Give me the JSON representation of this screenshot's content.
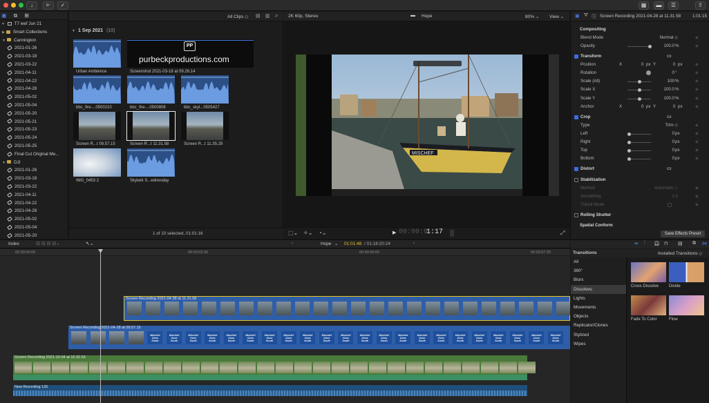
{
  "titlebar": {
    "controls": [
      "download-icon",
      "key-icon",
      "check-icon"
    ],
    "right_controls": [
      "layout-browser-icon",
      "layout-timeline-icon",
      "layout-inspector-icon",
      "share-icon"
    ]
  },
  "library": {
    "name": "T7 wef Jun 21",
    "items": [
      {
        "label": "Smart Collections",
        "type": "folder",
        "indent": 1
      },
      {
        "label": "Cannington",
        "type": "folder-open",
        "indent": 1
      },
      {
        "label": "2021-01-26",
        "type": "event",
        "indent": 2
      },
      {
        "label": "2021-03-18",
        "type": "event",
        "indent": 2
      },
      {
        "label": "2021-03-22",
        "type": "event",
        "indent": 2
      },
      {
        "label": "2021-04-11",
        "type": "event",
        "indent": 2
      },
      {
        "label": "2021-04-22",
        "type": "event",
        "indent": 2
      },
      {
        "label": "2021-04-28",
        "type": "event",
        "indent": 2
      },
      {
        "label": "2021-05-02",
        "type": "event",
        "indent": 2
      },
      {
        "label": "2021-05-04",
        "type": "event",
        "indent": 2
      },
      {
        "label": "2021-05-20",
        "type": "event",
        "indent": 2
      },
      {
        "label": "2021-05-21",
        "type": "event",
        "indent": 2
      },
      {
        "label": "2021-05-23",
        "type": "event",
        "indent": 2
      },
      {
        "label": "2021-05-24",
        "type": "event",
        "indent": 2
      },
      {
        "label": "2021-05-25",
        "type": "event",
        "indent": 2
      },
      {
        "label": "Final Cut Original Me...",
        "type": "event",
        "indent": 2
      },
      {
        "label": "DJI",
        "type": "folder-open",
        "indent": 1
      },
      {
        "label": "2021-01-26",
        "type": "event",
        "indent": 2
      },
      {
        "label": "2021-03-18",
        "type": "event",
        "indent": 2
      },
      {
        "label": "2021-03-22",
        "type": "event",
        "indent": 2
      },
      {
        "label": "2021-04-11",
        "type": "event",
        "indent": 2
      },
      {
        "label": "2021-04-22",
        "type": "event",
        "indent": 2
      },
      {
        "label": "2021-04-28",
        "type": "event",
        "indent": 2
      },
      {
        "label": "2021-05-02",
        "type": "event",
        "indent": 2
      },
      {
        "label": "2021-05-04",
        "type": "event",
        "indent": 2
      },
      {
        "label": "2021-05-20",
        "type": "event",
        "indent": 2
      }
    ]
  },
  "browser": {
    "filter": "All Clips ◇",
    "group_title": "1 Sep 2021",
    "group_count": "(10)",
    "clips": [
      {
        "label": "Urban Ambience",
        "kind": "audio"
      },
      {
        "label": "Screenshot 2021-03-18 at 09.26.14",
        "kind": "logo",
        "logo_text": "purbeckproductions.com",
        "logo_mark": "PP"
      },
      {
        "label": "bbc_fire-...0500210",
        "kind": "audio"
      },
      {
        "label": "bbc_fire-...0500808",
        "kind": "audio"
      },
      {
        "label": "bbc_skyl...0505427",
        "kind": "audio"
      },
      {
        "label": "Screen R...t 09.57.15",
        "kind": "video"
      },
      {
        "label": "Screen R...t 11.31.58",
        "kind": "video"
      },
      {
        "label": "Screen R...t 11.35.29",
        "kind": "video"
      },
      {
        "label": "IMG_0453 2",
        "kind": "sky"
      },
      {
        "label": "Skylark S...ednesday",
        "kind": "audio"
      }
    ],
    "status": "1 of 10 selected, 01:01:16"
  },
  "viewer": {
    "format": "2K 60p, Stereo",
    "project": "Hope",
    "zoom": "80% ⌄",
    "view": "View ⌄",
    "timecode_dim": "00:00:0",
    "timecode": "1:17",
    "boat_name": "MISCHEF"
  },
  "inspector": {
    "title": "Screen Recording 2021-04-28 at 11.31.58",
    "duration": "1:01:15",
    "rows": [
      {
        "label": "Compositing",
        "section": true
      },
      {
        "label": "Blend Mode",
        "value": "Normal ◇"
      },
      {
        "label": "Opacity",
        "value": "100.0",
        "unit": "%",
        "slider": 1.0
      },
      {
        "label": "Transform",
        "section": true,
        "checked": true
      },
      {
        "label": "Position",
        "x_label": "X",
        "x": "0",
        "x_unit": "px",
        "y_label": "Y",
        "y": "0",
        "y_unit": "px"
      },
      {
        "label": "Rotation",
        "value": "0",
        "unit": "°",
        "dial": true
      },
      {
        "label": "Scale (All)",
        "value": "100",
        "unit": "%",
        "slider": 0.5
      },
      {
        "label": "Scale X",
        "value": "100.0",
        "unit": "%",
        "slider": 0.5
      },
      {
        "label": "Scale Y",
        "value": "100.0",
        "unit": "%",
        "slider": 0.5
      },
      {
        "label": "Anchor",
        "x_label": "X",
        "x": "0",
        "x_unit": "px",
        "y_label": "Y",
        "y": "0",
        "y_unit": "px"
      },
      {
        "label": "Crop",
        "section": true,
        "checked": true
      },
      {
        "label": "Type",
        "value": "Trim ◇"
      },
      {
        "label": "Left",
        "value": "0",
        "unit": "px",
        "slider": 0.0
      },
      {
        "label": "Right",
        "value": "0",
        "unit": "px",
        "slider": 0.0
      },
      {
        "label": "Top",
        "value": "0",
        "unit": "px",
        "slider": 0.0
      },
      {
        "label": "Bottom",
        "value": "0",
        "unit": "px",
        "slider": 0.0
      },
      {
        "label": "Distort",
        "section": true,
        "checked": true
      },
      {
        "label": "Stabilization",
        "section": true,
        "checked": false
      },
      {
        "label": "Method",
        "value": "Automatic ◇",
        "dim": true
      },
      {
        "label": "Smoothing",
        "value": "1.0",
        "dim": true
      },
      {
        "label": "Tripod Mode",
        "dim": true
      },
      {
        "label": "Rolling Shutter",
        "section": true,
        "checked": false
      },
      {
        "label": "Spatial Conform",
        "section": true
      }
    ],
    "save_preset": "Save Effects Preset"
  },
  "timeline": {
    "index_label": "Index",
    "project": "Hope",
    "position": "01:01:48",
    "duration": "/ 01:18:20:24",
    "ruler": [
      "00:00:00:00",
      "00:00:02:30",
      "00:00:05:00",
      "00:00:07:30"
    ],
    "clips": [
      {
        "label": "Screen Recording 2021-04-28 at 11.31.58"
      },
      {
        "label": "Screen Recording 2021-04-28 at 09.57.15"
      },
      {
        "label": "Screen Recording 2021-10-04 at 10.32.53"
      },
      {
        "label": "New Recording 135"
      }
    ],
    "title_card": "Mischief Goes South"
  },
  "transitions": {
    "title": "Transitions",
    "installed": "Installed Transitions ◇",
    "categories": [
      "All",
      "360°",
      "Blurs",
      "Dissolves",
      "Lights",
      "Movements",
      "Objects",
      "Replicator/Clones",
      "Stylized",
      "Wipes"
    ],
    "selected_category": "Dissolves",
    "items": [
      {
        "label": "Cross Dissolve"
      },
      {
        "label": "Divide"
      },
      {
        "label": "Fade To Color"
      },
      {
        "label": "Flow"
      }
    ]
  },
  "colors": {
    "accent": "#3b6de0",
    "selection": "#e6c229",
    "video_clip": "#2f5ea8",
    "audio_clip": "#3c8f62"
  }
}
